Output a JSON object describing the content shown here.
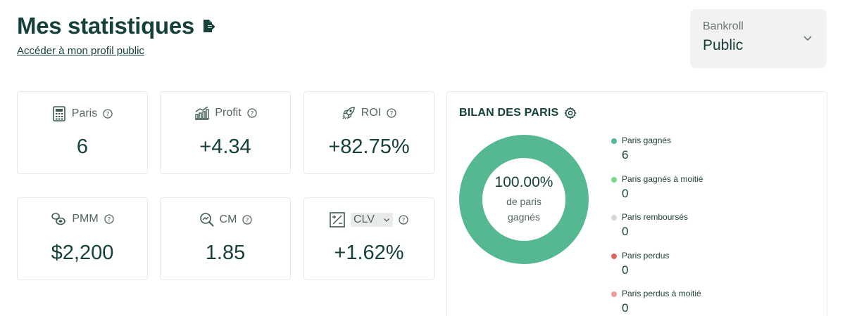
{
  "page": {
    "title": "Mes statistiques",
    "profile_link": "Accéder à mon profil public"
  },
  "bankroll": {
    "label": "Bankroll",
    "value": "Public"
  },
  "stats": {
    "paris": {
      "label": "Paris",
      "value": "6"
    },
    "profit": {
      "label": "Profit",
      "value": "+4.34"
    },
    "roi": {
      "label": "ROI",
      "value": "+82.75%"
    },
    "pmm": {
      "label": "PMM",
      "value": "$2,200"
    },
    "cm": {
      "label": "CM",
      "value": "1.85"
    },
    "clv": {
      "label": "CLV",
      "value": "+1.62%"
    }
  },
  "bilan": {
    "title": "BILAN DES PARIS",
    "center_pct": "100.00%",
    "center_sub": "de paris gagnés",
    "legend": [
      {
        "label": "Paris gagnés",
        "value": "6",
        "color": "#55b891"
      },
      {
        "label": "Paris gagnés à moitié",
        "value": "0",
        "color": "#7fd98c"
      },
      {
        "label": "Paris remboursés",
        "value": "0",
        "color": "#d6d6d6"
      },
      {
        "label": "Paris perdus",
        "value": "0",
        "color": "#e06565"
      },
      {
        "label": "Paris perdus à moitié",
        "value": "0",
        "color": "#ec9a9a"
      }
    ]
  },
  "colors": {
    "primary": "#16403a",
    "donut": "#55b891",
    "card_border": "#e7e9e8"
  }
}
